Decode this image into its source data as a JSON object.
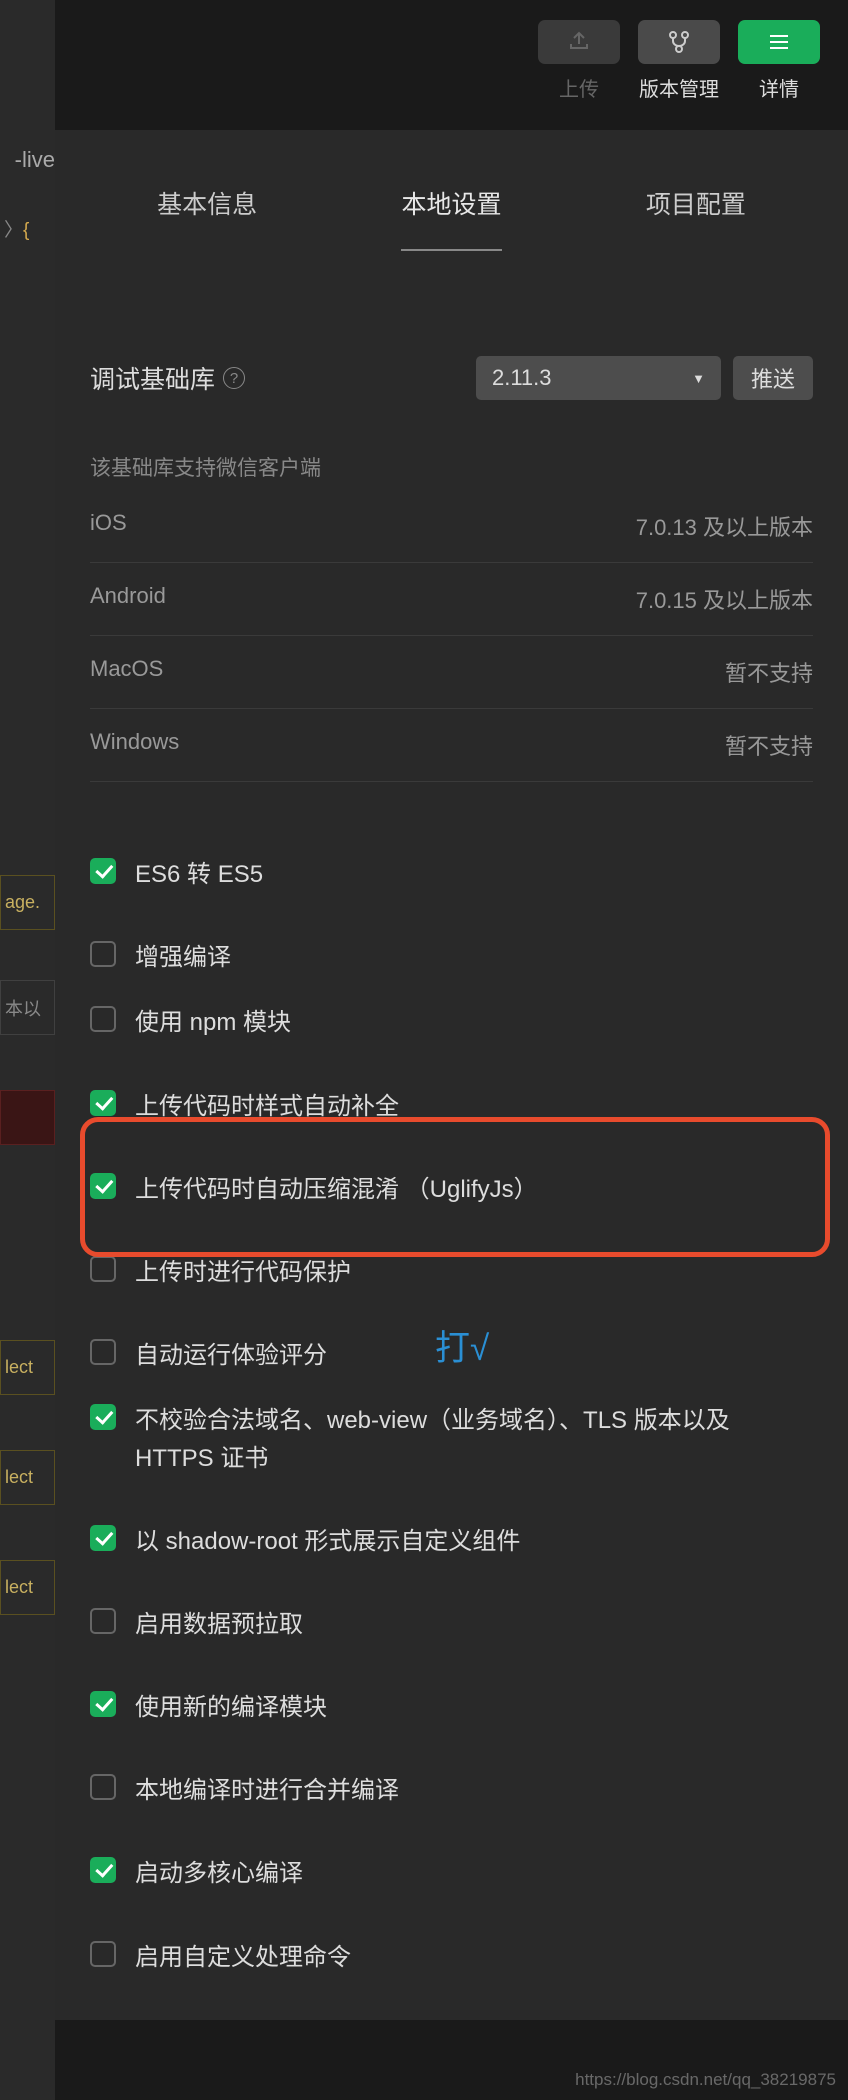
{
  "toolbar": {
    "upload": "上传",
    "version": "版本管理",
    "details": "详情"
  },
  "left_frag": {
    "live": "-live",
    "crumb_end": " 〉",
    "age": "age.",
    "ben": "本以",
    "lect": "lect"
  },
  "tabs": {
    "basic": "基本信息",
    "local": "本地设置",
    "project": "项目配置"
  },
  "debug": {
    "label": "调试基础库",
    "version": "2.11.3",
    "push": "推送",
    "caption": "该基础库支持微信客户端",
    "rows": [
      {
        "k": "iOS",
        "v": "7.0.13 及以上版本"
      },
      {
        "k": "Android",
        "v": "7.0.15 及以上版本"
      },
      {
        "k": "MacOS",
        "v": "暂不支持"
      },
      {
        "k": "Windows",
        "v": "暂不支持"
      }
    ]
  },
  "checks": [
    {
      "checked": true,
      "label": "ES6 转 ES5"
    },
    {
      "checked": false,
      "label": "增强编译"
    },
    {
      "checked": false,
      "label": "使用 npm 模块"
    },
    {
      "checked": true,
      "label": "上传代码时样式自动补全"
    },
    {
      "checked": true,
      "label": "上传代码时自动压缩混淆  （UglifyJs）"
    },
    {
      "checked": false,
      "label": "上传时进行代码保护"
    },
    {
      "checked": false,
      "label": "自动运行体验评分"
    },
    {
      "checked": true,
      "label": "不校验合法域名、web-view（业务域名）、TLS 版本以及 HTTPS 证书"
    },
    {
      "checked": true,
      "label": "以 shadow-root 形式展示自定义组件"
    },
    {
      "checked": false,
      "label": "启用数据预拉取"
    },
    {
      "checked": true,
      "label": "使用新的编译模块"
    },
    {
      "checked": false,
      "label": "本地编译时进行合并编译"
    },
    {
      "checked": true,
      "label": "启动多核心编译"
    },
    {
      "checked": false,
      "label": "启用自定义处理命令"
    }
  ],
  "annotation": "打√",
  "watermark": "https://blog.csdn.net/qq_38219875"
}
